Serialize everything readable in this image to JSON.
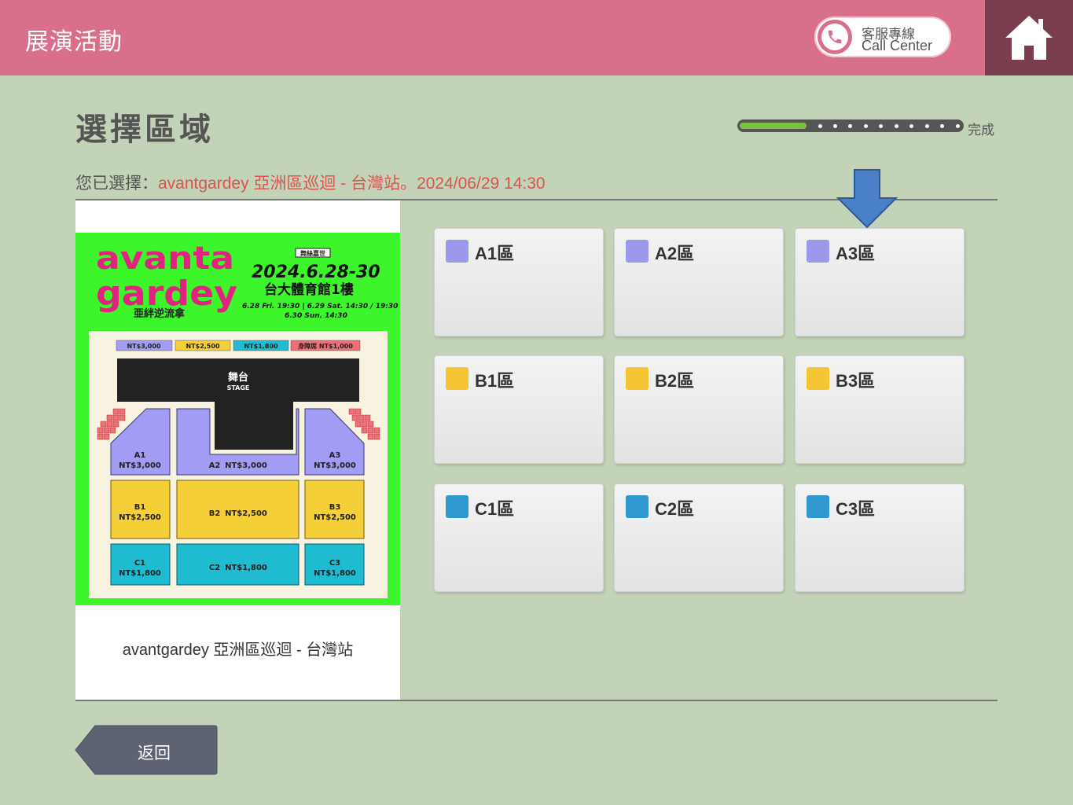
{
  "header": {
    "title": "展演活動",
    "call_center": {
      "line1": "客服專線",
      "line2": "Call Center",
      "icon": "phone-icon"
    },
    "home_icon": "home-icon"
  },
  "page": {
    "title": "選擇區域",
    "progress": {
      "fraction": 0.3,
      "label": "完成"
    },
    "selected_prefix": "您已選擇：",
    "selected_value": "avantgardey 亞洲區巡迴 - 台灣站。2024/06/29 14:30"
  },
  "poster": {
    "logo_line1": "avanta",
    "logo_line2": "gardey",
    "logo_sub": "亜絆逆流拿",
    "tag": "舞絲嘉世",
    "dates": "2024.6.28-30",
    "venue": "台大體育館1樓",
    "times1": "6.28 Fri. 19:30 | 6.29 Sat. 14:30 / 19:30",
    "times2": "6.30 Sun. 14:30",
    "legend": [
      "NT$3,000",
      "NT$2,500",
      "NT$1,800",
      "身障席 NT$1,000"
    ],
    "stage": "舞台",
    "stage_en": "STAGE",
    "seats": {
      "A1": {
        "name": "A1",
        "price": "NT$3,000"
      },
      "A2": {
        "name": "A2",
        "price": "NT$3,000"
      },
      "A3": {
        "name": "A3",
        "price": "NT$3,000"
      },
      "B1": {
        "name": "B1",
        "price": "NT$2,500"
      },
      "B2": {
        "name": "B2",
        "price": "NT$2,500"
      },
      "B3": {
        "name": "B3",
        "price": "NT$2,500"
      },
      "C1": {
        "name": "C1",
        "price": "NT$1,800"
      },
      "C2": {
        "name": "C2",
        "price": "NT$1,800"
      },
      "C3": {
        "name": "C3",
        "price": "NT$1,800"
      }
    },
    "caption": "avantgardey 亞洲區巡迴 - 台灣站"
  },
  "zones": [
    {
      "label": "A1區",
      "color": "#9b99ea"
    },
    {
      "label": "A2區",
      "color": "#9b99ea"
    },
    {
      "label": "A3區",
      "color": "#9b99ea"
    },
    {
      "label": "B1區",
      "color": "#f3c533"
    },
    {
      "label": "B2區",
      "color": "#f3c533"
    },
    {
      "label": "B3區",
      "color": "#f3c533"
    },
    {
      "label": "C1區",
      "color": "#2e98cf"
    },
    {
      "label": "C2區",
      "color": "#2e98cf"
    },
    {
      "label": "C3區",
      "color": "#2e98cf"
    }
  ],
  "back_label": "返回"
}
